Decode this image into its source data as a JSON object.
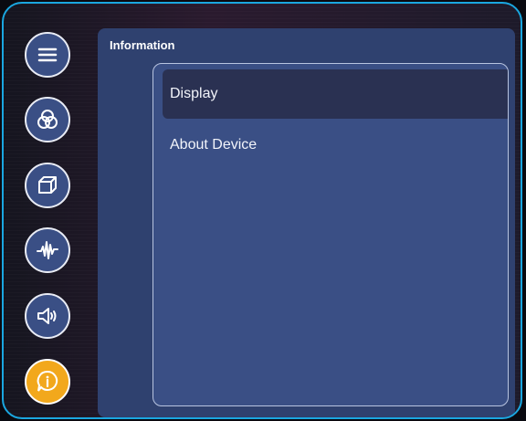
{
  "sidebar": {
    "items": [
      {
        "icon": "menu-icon",
        "active": false
      },
      {
        "icon": "color-circles-icon",
        "active": false
      },
      {
        "icon": "3d-box-icon",
        "active": false
      },
      {
        "icon": "waveform-icon",
        "active": false
      },
      {
        "icon": "speaker-icon",
        "active": false
      },
      {
        "icon": "info-icon",
        "active": true
      }
    ]
  },
  "panel": {
    "title": "Information",
    "items": [
      {
        "label": "Display",
        "selected": true
      },
      {
        "label": "About Device",
        "selected": false
      }
    ]
  },
  "colors": {
    "accent": "#f2a81c",
    "frame_border": "#1aa7e0",
    "panel_bg": "#2f416f",
    "menu_bg": "#3a4f85",
    "selected_bg": "#2a3152"
  }
}
